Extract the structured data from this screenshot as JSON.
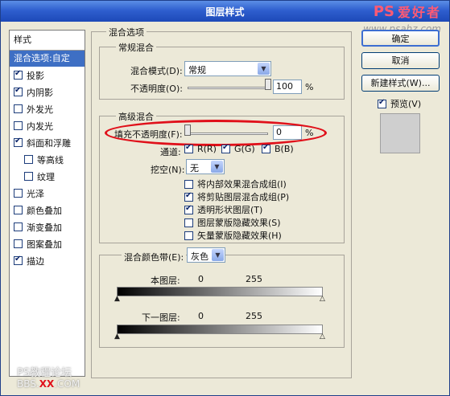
{
  "window": {
    "title": "图层样式"
  },
  "watermark": {
    "logo_ps": "PS",
    "logo_text": "爱好者",
    "url": "www.psahz.com",
    "bottom_line1": "PS教程论坛",
    "bottom_pre": "BBS.",
    "bottom_red": "XX",
    "bottom_post": ".COM"
  },
  "sidebar": {
    "header": "样式",
    "selected": "混合选项:自定",
    "items": [
      {
        "label": "投影",
        "checked": true,
        "indent": false
      },
      {
        "label": "内阴影",
        "checked": true,
        "indent": false
      },
      {
        "label": "外发光",
        "checked": false,
        "indent": false
      },
      {
        "label": "内发光",
        "checked": false,
        "indent": false
      },
      {
        "label": "斜面和浮雕",
        "checked": true,
        "indent": false
      },
      {
        "label": "等高线",
        "checked": false,
        "indent": true
      },
      {
        "label": "纹理",
        "checked": false,
        "indent": true
      },
      {
        "label": "光泽",
        "checked": false,
        "indent": false
      },
      {
        "label": "颜色叠加",
        "checked": false,
        "indent": false
      },
      {
        "label": "渐变叠加",
        "checked": false,
        "indent": false
      },
      {
        "label": "图案叠加",
        "checked": false,
        "indent": false
      },
      {
        "label": "描边",
        "checked": true,
        "indent": false
      }
    ]
  },
  "blending": {
    "section_title": "混合选项",
    "general": {
      "title": "常规混合",
      "mode_label": "混合模式(D):",
      "mode_value": "常规",
      "opacity_label": "不透明度(O):",
      "opacity_value": "100",
      "opacity_unit": "%",
      "opacity_level": 1.0
    },
    "advanced": {
      "title": "高级混合",
      "fill_label": "填充不透明度(F):",
      "fill_value": "0",
      "fill_unit": "%",
      "fill_level": 0.0,
      "channels_label": "通道:",
      "channels": [
        {
          "label": "R(R)",
          "checked": true
        },
        {
          "label": "G(G)",
          "checked": true
        },
        {
          "label": "B(B)",
          "checked": true
        }
      ],
      "knockout_label": "挖空(N):",
      "knockout_value": "无",
      "options": [
        {
          "label": "将内部效果混合成组(I)",
          "checked": false
        },
        {
          "label": "将剪贴图层混合成组(P)",
          "checked": true
        },
        {
          "label": "透明形状图层(T)",
          "checked": true
        },
        {
          "label": "图层蒙版隐藏效果(S)",
          "checked": false
        },
        {
          "label": "矢量蒙版隐藏效果(H)",
          "checked": false
        }
      ]
    },
    "blend_if": {
      "label": "混合颜色带(E):",
      "value": "灰色",
      "this_layer_label": "本图层:",
      "this_min": "0",
      "this_max": "255",
      "underlying_label": "下一图层:",
      "under_min": "0",
      "under_max": "255"
    }
  },
  "buttons": {
    "ok": "确定",
    "cancel": "取消",
    "new_style": "新建样式(W)...",
    "preview_label": "预览(V)",
    "preview_checked": true
  }
}
